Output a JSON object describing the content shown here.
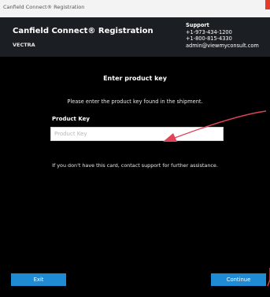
{
  "window": {
    "title": "Canfield Connect® Registration"
  },
  "header": {
    "title": "Canfield Connect® Registration",
    "subtitle": "VECTRA",
    "support": {
      "heading": "Support",
      "phone1": "+1-973-434-1200",
      "phone2": "+1-800-815-4330",
      "email": "admin@viewmyconsult.com"
    }
  },
  "main": {
    "heading": "Enter product key",
    "instruction": "Please enter the product key found in the shipment.",
    "field_label": "Product Key",
    "field_placeholder": "Product Key",
    "field_value": "",
    "help_text": "If you don't have this card, contact support for further assistance."
  },
  "buttons": {
    "exit": "Exit",
    "continue": "Continue"
  },
  "colors": {
    "background": "#000000",
    "header": "#1b1f24",
    "button": "#1e8bd4",
    "annotation_arrow": "#e0435a",
    "close_button": "#e23c2b"
  }
}
